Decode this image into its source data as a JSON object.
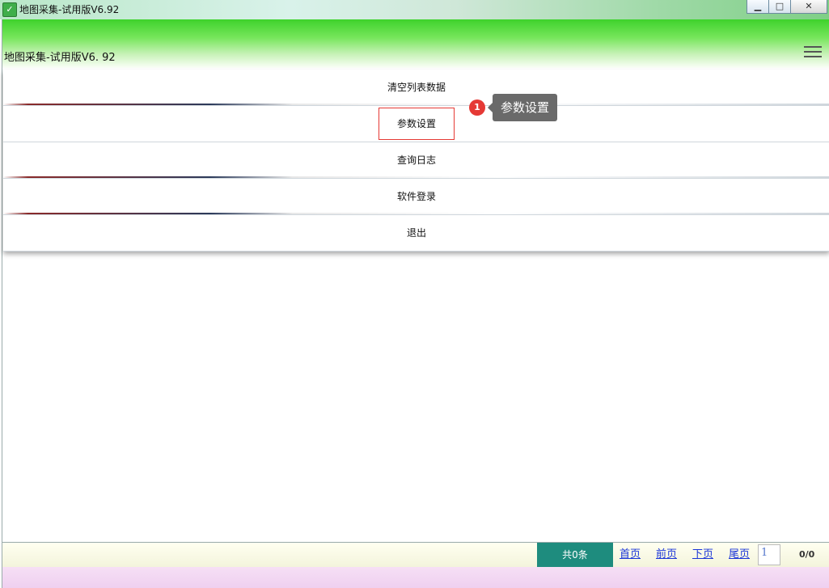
{
  "window": {
    "title": "地图采集-试用版V6.92",
    "controls": {
      "minimize": "▁",
      "maximize": "□",
      "close": "✕"
    }
  },
  "app": {
    "title": "地图采集-试用版V6. 92"
  },
  "menu": {
    "items": [
      {
        "label": "清空列表数据"
      },
      {
        "label": "参数设置"
      },
      {
        "label": "查询日志"
      },
      {
        "label": "软件登录"
      },
      {
        "label": "退出"
      }
    ]
  },
  "annotation": {
    "badge": "1",
    "tooltip": "参数设置"
  },
  "pager": {
    "total": "共0条",
    "first": "首页",
    "prev": "前页",
    "next": "下页",
    "last": "尾页",
    "page_value": "1",
    "count": "0/0"
  },
  "colors": {
    "header_green": "#3fd22c",
    "highlight_red": "#e53935",
    "pager_teal": "#1e8c7e",
    "link_blue": "#1a35d8"
  },
  "icons": [
    "app-leaf-icon",
    "hamburger-menu-icon"
  ]
}
